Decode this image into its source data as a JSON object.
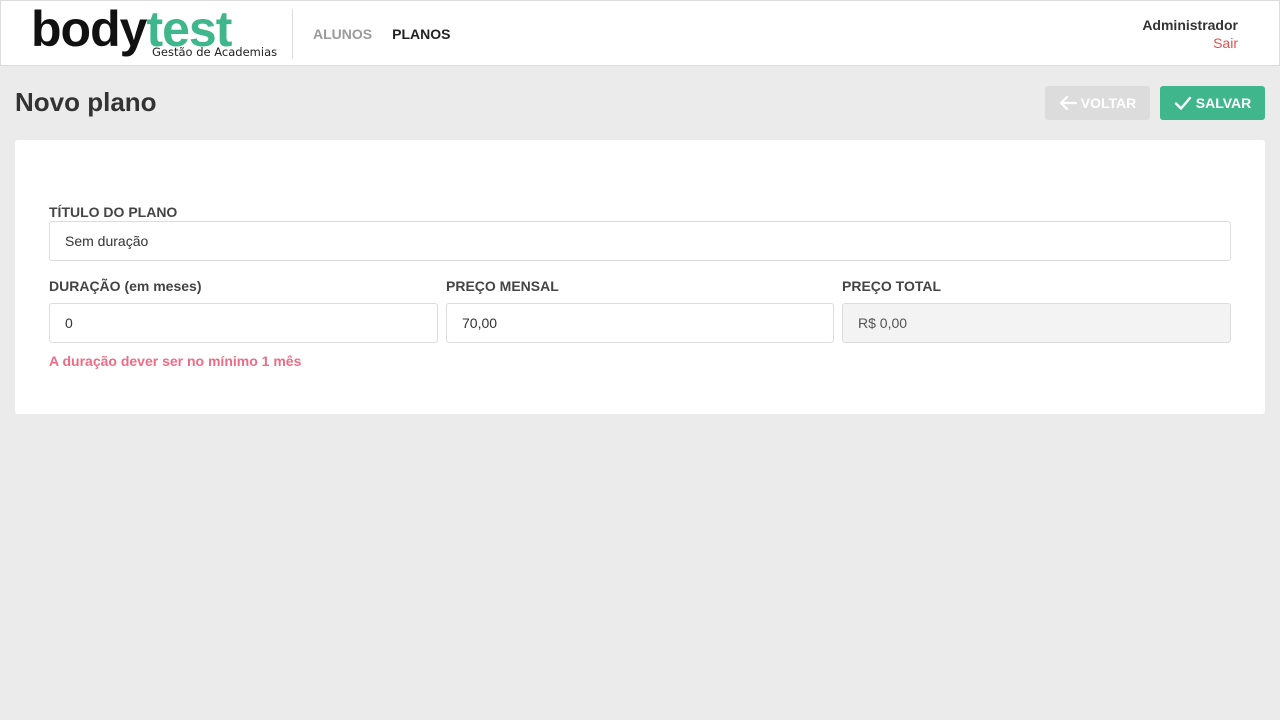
{
  "brand": {
    "word_dark": "body",
    "word_accent": "test",
    "tagline": "Gestão de Academias"
  },
  "nav": {
    "items": [
      {
        "label": "ALUNOS",
        "active": false
      },
      {
        "label": "PLANOS",
        "active": true
      }
    ]
  },
  "user": {
    "name": "Administrador",
    "logout": "Sair"
  },
  "page": {
    "title": "Novo plano"
  },
  "actions": {
    "back_label": "VOLTAR",
    "save_label": "SALVAR"
  },
  "form": {
    "title_label": "TÍTULO DO PLANO",
    "title_value": "Sem duração",
    "duration_label": "DURAÇÃO (em meses)",
    "duration_value": "0",
    "monthly_label": "PREÇO MENSAL",
    "monthly_value": "70,00",
    "total_label": "PREÇO TOTAL",
    "total_value": "R$ 0,00",
    "error_message": "A duração dever ser no mínimo 1 mês"
  },
  "colors": {
    "accent": "#3fb68b",
    "logout": "#d9534f",
    "error": "#ef6b85",
    "background": "#ebebeb"
  },
  "icons": {
    "back": "arrow-left-icon",
    "save": "check-icon"
  }
}
